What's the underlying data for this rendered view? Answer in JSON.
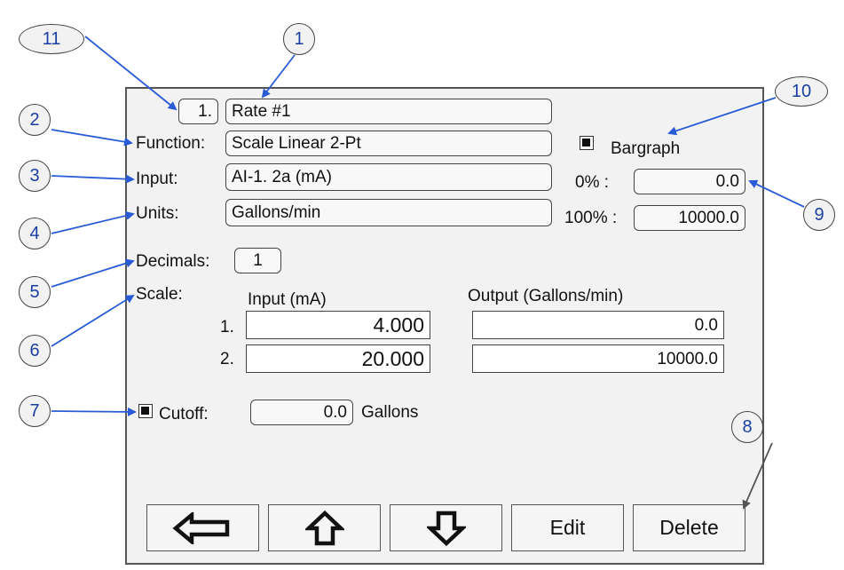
{
  "record": {
    "index": "1.",
    "name": "Rate #1"
  },
  "function": {
    "label": "Function:",
    "value": "Scale Linear 2-Pt"
  },
  "input": {
    "label": "Input:",
    "value": "AI-1. 2a (mA)"
  },
  "units": {
    "label": "Units:",
    "value": "Gallons/min"
  },
  "decimals": {
    "label": "Decimals:",
    "value": "1"
  },
  "scale": {
    "label": "Scale:",
    "input_header": "Input (mA)",
    "output_header": "Output (Gallons/min)",
    "rows": [
      {
        "num": "1.",
        "input": "4.000",
        "output": "0.0"
      },
      {
        "num": "2.",
        "input": "20.000",
        "output": "10000.0"
      }
    ]
  },
  "cutoff": {
    "label": "Cutoff:",
    "value": "0.0",
    "unit": "Gallons",
    "checked": true
  },
  "bargraph": {
    "label": "Bargraph",
    "checked": true,
    "zero_label": "0% :",
    "zero_value": "0.0",
    "full_label": "100% :",
    "full_value": "10000.0"
  },
  "buttons": {
    "edit": "Edit",
    "delete": "Delete"
  },
  "callouts": {
    "c1": "1",
    "c2": "2",
    "c3": "3",
    "c4": "4",
    "c5": "5",
    "c6": "6",
    "c7": "7",
    "c8": "8",
    "c9": "9",
    "c10": "10",
    "c11": "11"
  },
  "colors": {
    "callout_text": "#1a3fa3",
    "arrow": "#2a5bd7",
    "arrow_gray": "#555555"
  }
}
